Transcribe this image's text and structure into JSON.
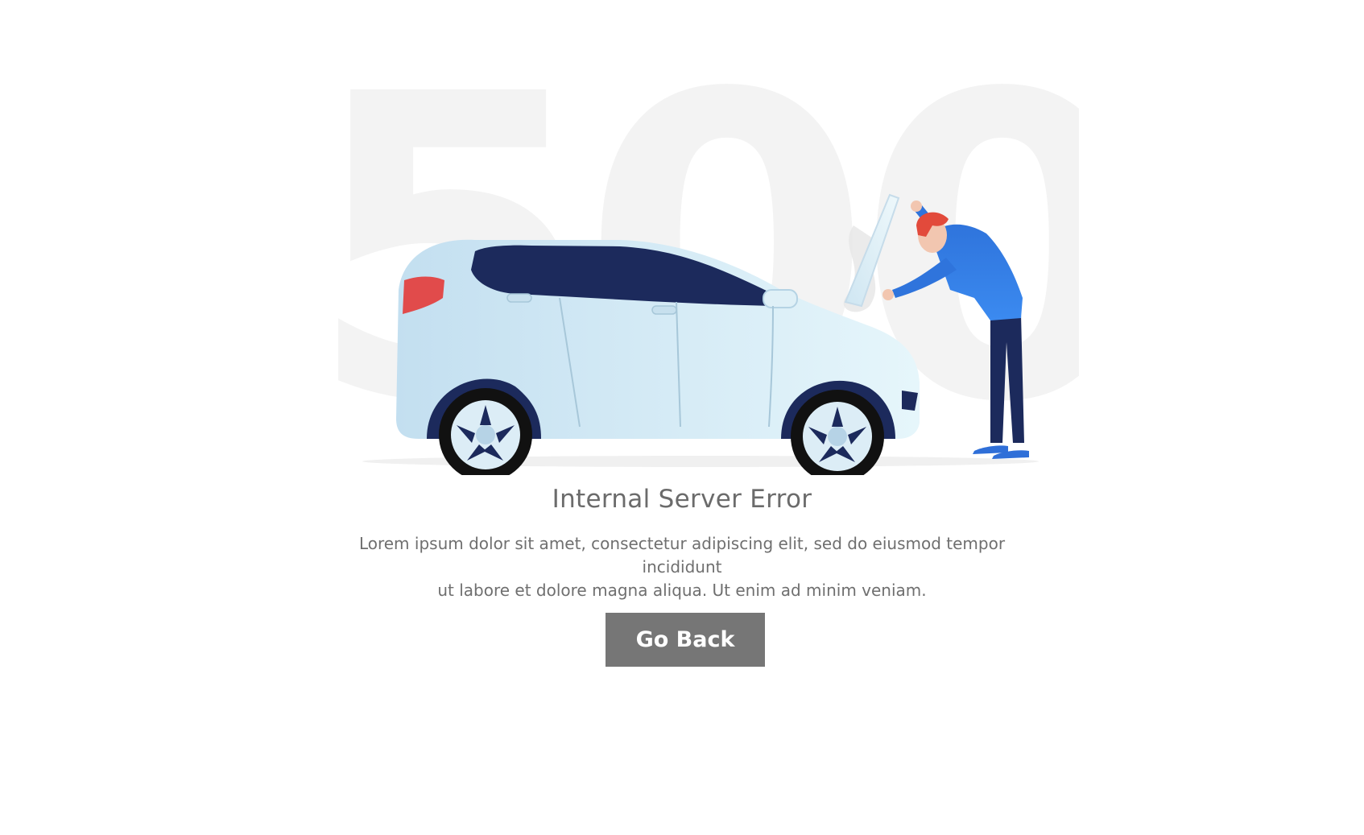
{
  "background_code": "500",
  "error": {
    "title": "Internal Server Error",
    "description_line1": "Lorem ipsum dolor sit amet, consectetur adipiscing elit, sed do eiusmod tempor incididunt",
    "description_line2": "ut labore et dolore magna aliqua. Ut enim ad minim veniam."
  },
  "actions": {
    "go_back_label": "Go Back"
  },
  "illustration": {
    "subject": "mechanic-repairing-car-icon",
    "colors": {
      "car_body": "#d6ecf4",
      "car_window": "#1c2a5c",
      "tail_light": "#e14b4b",
      "shirt": "#2f6fd8",
      "pants": "#1c2a5c",
      "hair": "#e24a3b"
    }
  },
  "colors": {
    "button_bg": "#767676",
    "title_text": "#6b6b6b",
    "body_text": "#6f6f6f",
    "background_number": "#f3f3f3"
  }
}
